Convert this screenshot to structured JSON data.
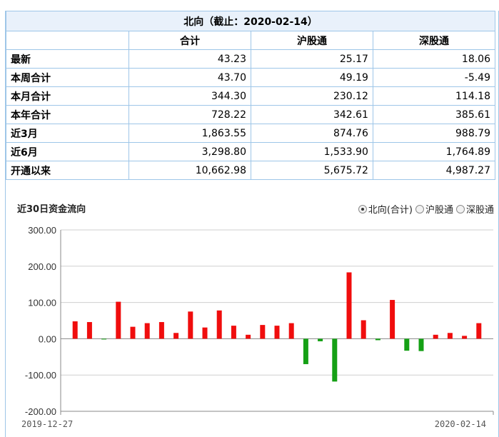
{
  "table": {
    "title": "北向（截止：2020-02-14）",
    "columns": [
      "",
      "合计",
      "沪股通",
      "深股通"
    ],
    "rows": [
      {
        "label": "最新",
        "total": "43.23",
        "sh": "25.17",
        "sz": "18.06"
      },
      {
        "label": "本周合计",
        "total": "43.70",
        "sh": "49.19",
        "sz": "-5.49"
      },
      {
        "label": "本月合计",
        "total": "344.30",
        "sh": "230.12",
        "sz": "114.18"
      },
      {
        "label": "本年合计",
        "total": "728.22",
        "sh": "342.61",
        "sz": "385.61"
      },
      {
        "label": "近3月",
        "total": "1,863.55",
        "sh": "874.76",
        "sz": "988.79"
      },
      {
        "label": "近6月",
        "total": "3,298.80",
        "sh": "1,533.90",
        "sz": "1,764.89"
      },
      {
        "label": "开通以来",
        "total": "10,662.98",
        "sh": "5,675.72",
        "sz": "4,987.27"
      }
    ]
  },
  "chart_section": {
    "title": "近30日资金流向",
    "options": [
      {
        "label": "北向(合计)",
        "selected": true
      },
      {
        "label": "沪股通",
        "selected": false
      },
      {
        "label": "深股通",
        "selected": false
      }
    ]
  },
  "chart_data": {
    "type": "bar",
    "ylim": [
      -200,
      300
    ],
    "yticks": [
      "300.00",
      "200.00",
      "100.00",
      "0.00",
      "-100.00",
      "-200.00"
    ],
    "ytick_values": [
      300,
      200,
      100,
      0,
      -100,
      -200
    ],
    "x_start_label": "2019-12-27",
    "x_end_label": "2020-02-14",
    "values": [
      48,
      46,
      -2,
      102,
      33,
      43,
      46,
      16,
      75,
      31,
      78,
      36,
      11,
      38,
      36,
      43,
      -70,
      -7,
      -118,
      183,
      51,
      -4,
      107,
      -33,
      -34,
      11,
      16,
      8,
      43
    ],
    "colors": {
      "positive": "#f00d0d",
      "negative": "#15a015"
    }
  }
}
